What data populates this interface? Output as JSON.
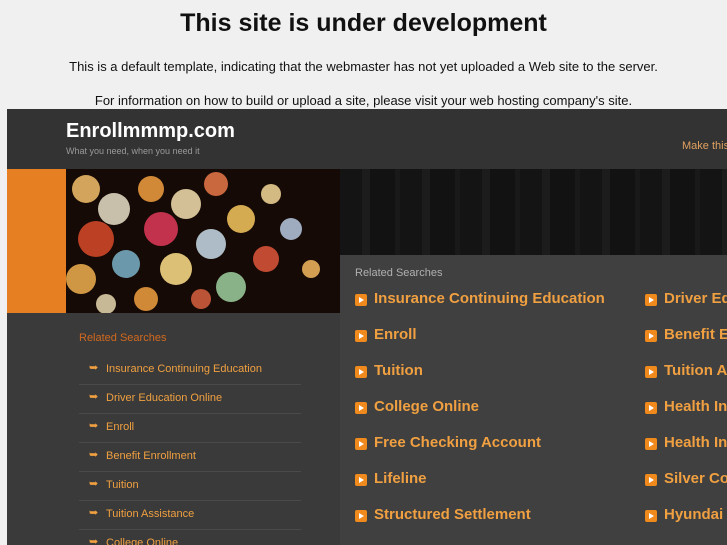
{
  "notice": {
    "title": "This site is under development",
    "line1": "This is a default template, indicating that the webmaster has not yet uploaded a Web site to the server.",
    "line2": "For information on how to build or upload a site, please visit your web hosting company's site."
  },
  "header": {
    "site_title": "Enrollmmmp.com",
    "tagline": "What you need, when you need it",
    "make_link": "Make this"
  },
  "left": {
    "heading": "Related Searches",
    "items": [
      {
        "label": "Insurance Continuing Education"
      },
      {
        "label": "Driver Education Online"
      },
      {
        "label": "Enroll"
      },
      {
        "label": "Benefit Enrollment"
      },
      {
        "label": "Tuition"
      },
      {
        "label": "Tuition Assistance"
      },
      {
        "label": "College Online"
      }
    ]
  },
  "right": {
    "heading": "Related Searches",
    "col1": [
      {
        "label": "Insurance Continuing Education"
      },
      {
        "label": "Enroll"
      },
      {
        "label": "Tuition"
      },
      {
        "label": "College Online"
      },
      {
        "label": "Free Checking Account"
      },
      {
        "label": "Lifeline"
      },
      {
        "label": "Structured Settlement"
      }
    ],
    "col2": [
      {
        "label": "Driver Ed"
      },
      {
        "label": "Benefit E"
      },
      {
        "label": "Tuition A"
      },
      {
        "label": "Health Ins"
      },
      {
        "label": "Health Ins"
      },
      {
        "label": "Silver Co"
      },
      {
        "label": "Hyundai I"
      }
    ]
  },
  "colors": {
    "accent": "#e67e22",
    "link": "#f0a040",
    "background": "#2b2b2b"
  },
  "icons": {
    "search": "magnifier-icon",
    "arrow": "arrow-bullet-icon"
  }
}
